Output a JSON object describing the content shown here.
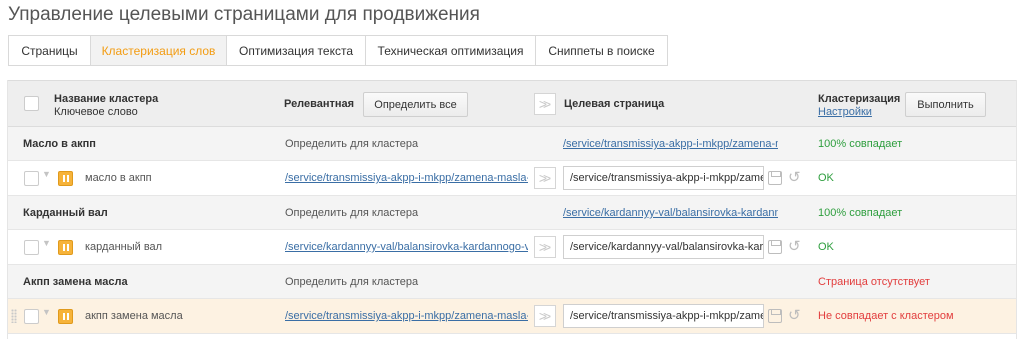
{
  "page": {
    "title": "Управление целевыми страницами для продвижения"
  },
  "tabs": [
    {
      "label": "Страницы",
      "active": false
    },
    {
      "label": "Кластеризация слов",
      "active": true
    },
    {
      "label": "Оптимизация текста",
      "active": false
    },
    {
      "label": "Техническая оптимизация",
      "active": false
    },
    {
      "label": "Сниппеты в поиске",
      "active": false
    }
  ],
  "table": {
    "header": {
      "cluster_name": "Название кластера",
      "keyword": "Ключевое слово",
      "relevant": "Релевантная",
      "detect_all_button": "Определить все",
      "target_page": "Целевая страница",
      "clusterization": "Кластеризация",
      "settings_link": "Настройки",
      "run_button": "Выполнить"
    },
    "rows": [
      {
        "cluster": {
          "name": "Масло в акпп",
          "relevant": "Определить для кластера",
          "target_link": "/service/transmissiya-akpp-i-mkpp/zamena-masla-v-akpp/",
          "status": "100% совпадает"
        },
        "keyword": {
          "name": "масло в акпп",
          "relevant_link": "/service/transmissiya-akpp-i-mkpp/zamena-masla-v-akpp/",
          "target_value": "/service/transmissiya-akpp-i-mkpp/zamena-masla-v-akpp/",
          "status": "OK"
        }
      },
      {
        "cluster": {
          "name": "Карданный вал",
          "relevant": "Определить для кластера",
          "target_link": "/service/kardannyy-val/balansirovka-kardannogo-vala/",
          "status": "100% совпадает"
        },
        "keyword": {
          "name": "карданный вал",
          "relevant_link": "/service/kardannyy-val/balansirovka-kardannogo-vala/",
          "target_value": "/service/kardannyy-val/balansirovka-kardannogo-vala/",
          "status": "OK"
        }
      },
      {
        "cluster": {
          "name": "Акпп замена масла",
          "relevant": "Определить для кластера",
          "target_link": "",
          "status": "Страница отсутствует"
        },
        "keyword": {
          "name": "акпп замена масла",
          "relevant_link": "/service/transmissiya-akpp-i-mkpp/zamena-masla-v-akpp/",
          "target_value": "/service/transmissiya-akpp-i-mkpp/zamena-masla-v-akpp/",
          "status": "Не совпадает с кластером"
        }
      }
    ]
  },
  "colors": {
    "accent": "#f39c12",
    "link": "#3a6ea5",
    "ok": "#2e9e3e",
    "error": "#e23d3d",
    "highlight_row": "#fdf2e2"
  },
  "icons": [
    "pause-icon",
    "double-chevron-right-icon",
    "save-icon",
    "undo-icon",
    "drag-handle-icon",
    "caret-down-icon"
  ]
}
